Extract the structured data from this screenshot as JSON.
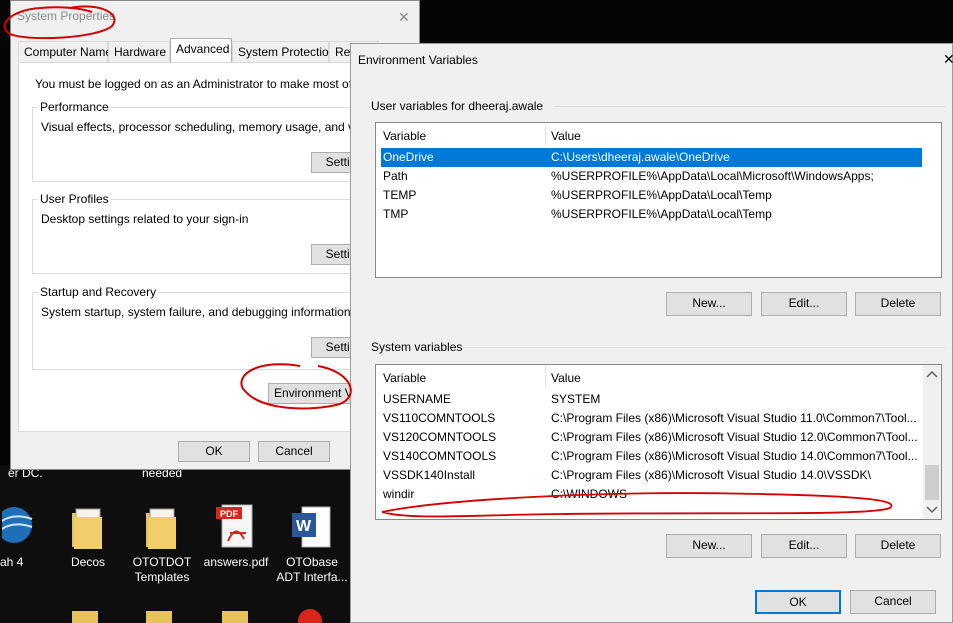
{
  "system_properties": {
    "title": "System Properties",
    "close_glyph": "✕",
    "tabs": [
      "Computer Name",
      "Hardware",
      "Advanced",
      "System Protection",
      "Rem"
    ],
    "admin_note": "You must be logged on as an Administrator to make most of these c",
    "performance": {
      "title": "Performance",
      "desc": "Visual effects, processor scheduling, memory usage, and virtual m",
      "button": "Settin"
    },
    "user_profiles": {
      "title": "User Profiles",
      "desc": "Desktop settings related to your sign-in",
      "button": "Settin"
    },
    "startup": {
      "title": "Startup and Recovery",
      "desc": "System startup, system failure, and debugging information",
      "button": "Settin"
    },
    "env_button": "Environment Var",
    "ok": "OK",
    "cancel": "Cancel"
  },
  "environment_variables": {
    "title": "Environment Variables",
    "close_glyph": "✕",
    "user_section": "User variables for dheeraj.awale",
    "user_headers": {
      "variable": "Variable",
      "value": "Value"
    },
    "user_vars": [
      {
        "name": "OneDrive",
        "value": "C:\\Users\\dheeraj.awale\\OneDrive"
      },
      {
        "name": "Path",
        "value": "%USERPROFILE%\\AppData\\Local\\Microsoft\\WindowsApps;"
      },
      {
        "name": "TEMP",
        "value": "%USERPROFILE%\\AppData\\Local\\Temp"
      },
      {
        "name": "TMP",
        "value": "%USERPROFILE%\\AppData\\Local\\Temp"
      }
    ],
    "user_buttons": {
      "new": "New...",
      "edit": "Edit...",
      "delete": "Delete"
    },
    "system_section": "System variables",
    "system_headers": {
      "variable": "Variable",
      "value": "Value"
    },
    "system_vars": [
      {
        "name": "USERNAME",
        "value": "SYSTEM"
      },
      {
        "name": "VS110COMNTOOLS",
        "value": "C:\\Program Files (x86)\\Microsoft Visual Studio 11.0\\Common7\\Tool..."
      },
      {
        "name": "VS120COMNTOOLS",
        "value": "C:\\Program Files (x86)\\Microsoft Visual Studio 12.0\\Common7\\Tool..."
      },
      {
        "name": "VS140COMNTOOLS",
        "value": "C:\\Program Files (x86)\\Microsoft Visual Studio 14.0\\Common7\\Tool..."
      },
      {
        "name": "VSSDK140Install",
        "value": "C:\\Program Files (x86)\\Microsoft Visual Studio 14.0\\VSSDK\\"
      },
      {
        "name": "windir",
        "value": "C:\\WINDOWS"
      }
    ],
    "system_buttons": {
      "new": "New...",
      "edit": "Edit...",
      "delete": "Delete"
    },
    "ok": "OK",
    "cancel": "Cancel"
  },
  "desktop": {
    "partial_label_1": "er DC.",
    "partial_label_2": "needed",
    "icons": [
      {
        "label": "ah 4"
      },
      {
        "label": "Decos"
      },
      {
        "label": "OTOTDOT\nTemplates"
      },
      {
        "label": "answers.pdf"
      },
      {
        "label": "OTObase\nADT Interfa..."
      }
    ]
  },
  "colors": {
    "accent": "#0078d7",
    "annotation": "#d40000"
  }
}
